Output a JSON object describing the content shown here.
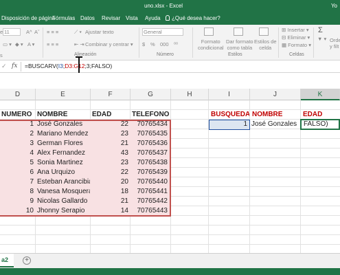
{
  "window": {
    "title": "uno.xlsx  -  Excel",
    "user": "Yo"
  },
  "ribbon_tabs": [
    "Disposición de página",
    "Fórmulas",
    "Datos",
    "Revisar",
    "Vista",
    "Ayuda",
    "¿Qué desea hacer?"
  ],
  "ribbon": {
    "font_size": "11",
    "wrap_text": "Ajustar texto",
    "merge_center": "Combinar y centrar",
    "number_format": "General",
    "currency_symbol": "$",
    "percent_symbol": "%",
    "conditional_format": [
      "Formato",
      "condicional"
    ],
    "format_as_table": [
      "Dar formato",
      "como tabla"
    ],
    "cell_styles": [
      "Estilos de",
      "celda"
    ],
    "insert": "Insertar",
    "delete": "Eliminar",
    "format": "Formato",
    "sort": "Orde",
    "sort2": "y filt",
    "sigma": "Σ",
    "groups": {
      "alignment": "Alineación",
      "number": "Número",
      "styles": "Estilos",
      "cells": "Celdas"
    },
    "left_frag": "e",
    "left_frag2": "s"
  },
  "formula_bar": {
    "cancel": "✓",
    "fx": "fx",
    "formula": {
      "prefix": "=BUSCARV(",
      "ref1": "I3",
      "sep1": ";",
      "ref2": "D3:G12",
      "sep2": ";",
      "ref3": "3",
      "suffix": ";FALSO)"
    }
  },
  "columns": [
    "D",
    "E",
    "F",
    "G",
    "H",
    "I",
    "J",
    "K"
  ],
  "table": {
    "headers": [
      "NUMERO",
      "NOMBRE",
      "EDAD",
      "TELEFONO"
    ],
    "rows": [
      {
        "numero": "1",
        "nombre": "José Gonzales",
        "edad": "22",
        "telefono": "70765434"
      },
      {
        "numero": "2",
        "nombre": "Mariano Mendez",
        "edad": "23",
        "telefono": "70765435"
      },
      {
        "numero": "3",
        "nombre": "German Flores",
        "edad": "21",
        "telefono": "70765436"
      },
      {
        "numero": "4",
        "nombre": "Alex Fernandez",
        "edad": "43",
        "telefono": "70765437"
      },
      {
        "numero": "5",
        "nombre": "Sonia Martinez",
        "edad": "23",
        "telefono": "70765438"
      },
      {
        "numero": "6",
        "nombre": "Ana Urquizo",
        "edad": "22",
        "telefono": "70765439"
      },
      {
        "numero": "7",
        "nombre": "Esteban Arancibia",
        "edad": "20",
        "telefono": "70765440"
      },
      {
        "numero": "8",
        "nombre": "Vanesa Mosquera",
        "edad": "18",
        "telefono": "70765441"
      },
      {
        "numero": "9",
        "nombre": "Nicolas Gallardo",
        "edad": "21",
        "telefono": "70765442"
      },
      {
        "numero": "10",
        "nombre": "Jhonny Serapio",
        "edad": "14",
        "telefono": "70765443"
      }
    ]
  },
  "lookup": {
    "headers": [
      "BUSQUEDA",
      "NOMBRE",
      "EDAD"
    ],
    "busqueda_value": "1",
    "nombre_value": "José Gonzales",
    "edad_value": "FALSO)"
  },
  "sheet_tab": "a2",
  "add_sheet": "+",
  "colors": {
    "excel_green": "#217346",
    "table_fill": "#f8e1e3",
    "table_border": "#c0504d",
    "ref_blue": "#1f4e9e",
    "ref_red": "#c00000",
    "lookup_fill": "#dce6f1"
  }
}
